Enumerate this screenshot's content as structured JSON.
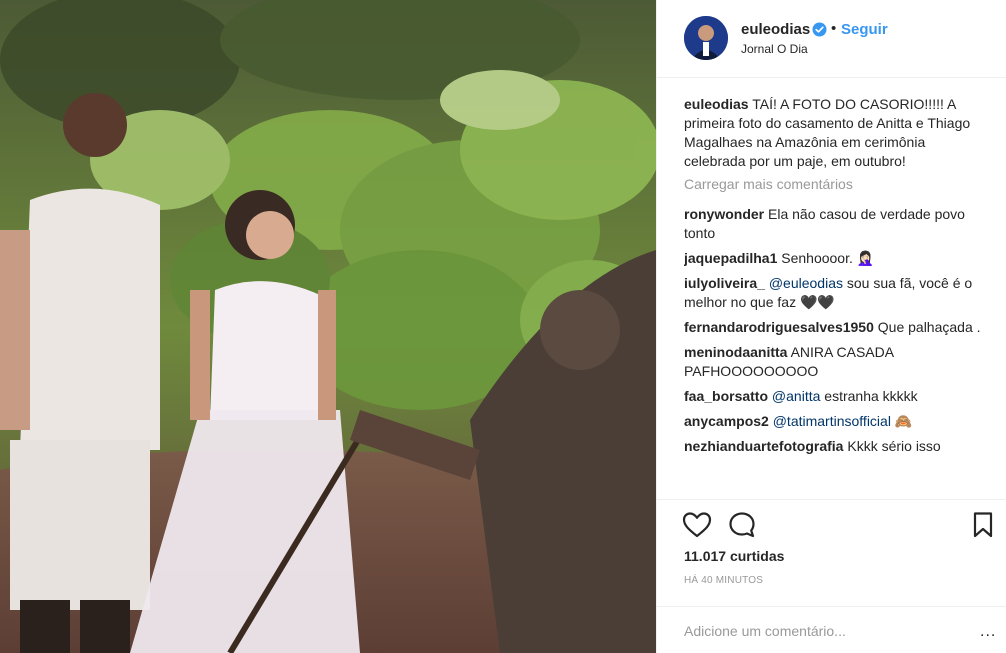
{
  "post": {
    "username": "euleodias",
    "verified": true,
    "separator": "•",
    "follow_label": "Seguir",
    "location": "Jornal O Dia"
  },
  "caption": {
    "username": "euleodias",
    "text": "TAÍ! A FOTO DO CASORIO!!!!! A primeira foto do casamento de Anitta e Thiago Magalhaes na Amazônia em cerimônia celebrada por um paje, em outubro!"
  },
  "load_more_label": "Carregar mais comentários",
  "comments": [
    {
      "username": "ronywonder",
      "text": "Ela não casou de verdade povo tonto"
    },
    {
      "username": "jaquepadilha1",
      "text": "Senhoooor. 🤦🏻‍♀️"
    },
    {
      "username": "iulyoliveira_",
      "mention": "@euleodias",
      "text": "sou sua fã, você é o melhor no que faz 🖤🖤"
    },
    {
      "username": "fernandarodriguesalves1950",
      "text": "Que palhaçada ."
    },
    {
      "username": "meninodaanitta",
      "text": "ANIRA CASADA PAFHOOOOOOOOO"
    },
    {
      "username": "faa_borsatto",
      "mention": "@anitta",
      "text": "estranha kkkkk"
    },
    {
      "username": "anycampos2",
      "mention": "@tatimartinsofficial",
      "text": "🙈"
    },
    {
      "username": "nezhianduartefotografia",
      "text": "Kkkk sério isso"
    }
  ],
  "likes_text": "11.017 curtidas",
  "timestamp": "HÁ 40 MINUTOS",
  "add_comment_placeholder": "Adicione um comentário...",
  "more_options": "...",
  "colors": {
    "link": "#3897f0",
    "muted": "#999999",
    "text": "#262626",
    "verified": "#3897f0"
  }
}
